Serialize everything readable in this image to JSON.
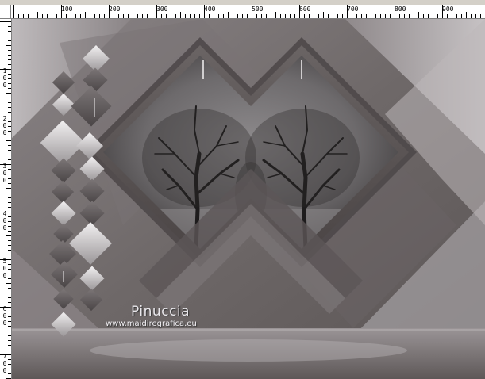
{
  "ruler": {
    "h_labels": [
      "100",
      "200",
      "300",
      "400",
      "500",
      "600",
      "700",
      "800",
      "900"
    ],
    "v_labels": [
      "1\n0\n0",
      "2\n0\n0",
      "3\n0\n0",
      "4\n0\n0",
      "5\n0\n0",
      "6\n0\n0",
      "7\n0\n0"
    ]
  },
  "artwork": {
    "signature_name": "Pinuccia",
    "signature_url": "www.maidiregrafica.eu"
  },
  "colors": {
    "bg_dark": "#5e5857",
    "bg_light": "#a9a4a6",
    "accent": "#cfcccd",
    "ruler_bg": "#ffffff",
    "ui_chrome": "#d4d0c8"
  }
}
